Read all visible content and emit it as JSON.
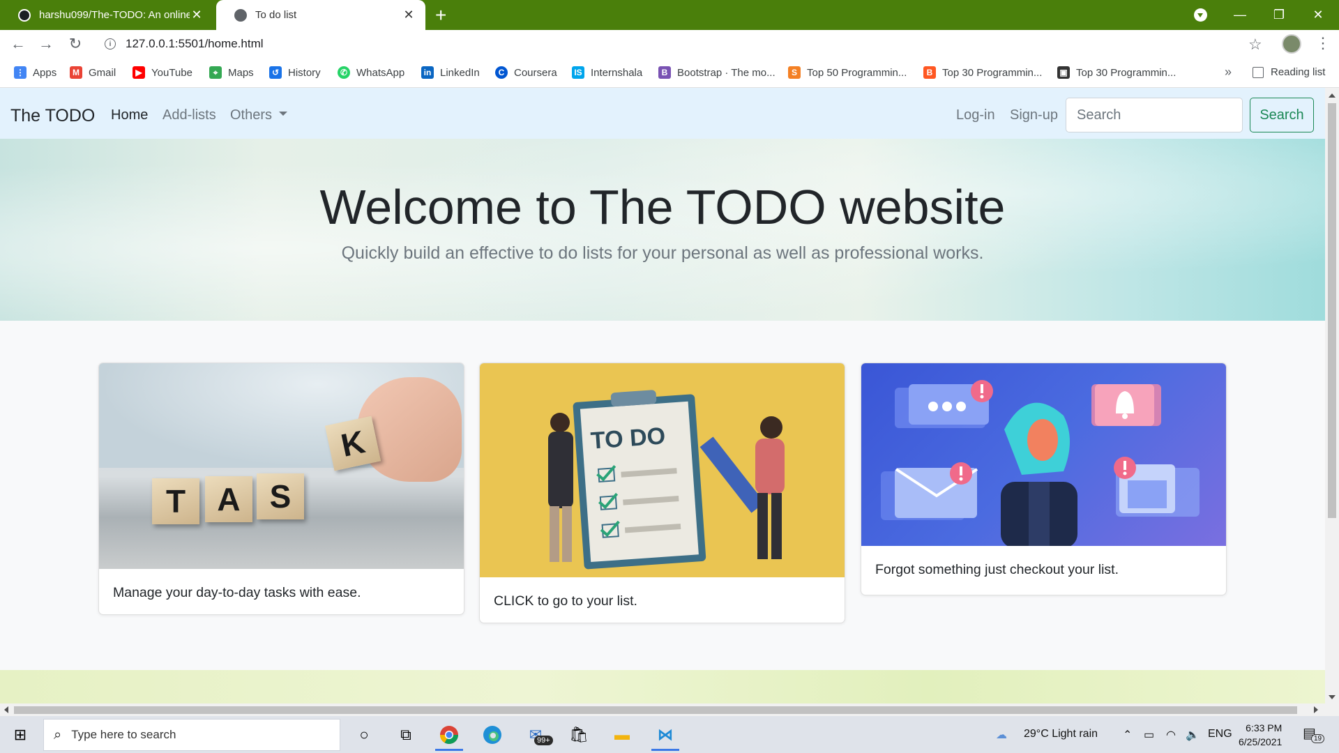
{
  "browser": {
    "tabs": [
      {
        "title": "harshu099/The-TODO: An online",
        "active": false
      },
      {
        "title": "To do list",
        "active": true
      }
    ],
    "url": "127.0.0.1:5501/home.html",
    "bookmarks": [
      {
        "label": "Apps",
        "icon": "apps-grid-icon",
        "color": "#4285f4"
      },
      {
        "label": "Gmail",
        "icon": "gmail-icon",
        "color": "#ea4335"
      },
      {
        "label": "YouTube",
        "icon": "youtube-icon",
        "color": "#ff0000"
      },
      {
        "label": "Maps",
        "icon": "maps-icon",
        "color": "#34a853"
      },
      {
        "label": "History",
        "icon": "history-icon",
        "color": "#1a73e8"
      },
      {
        "label": "WhatsApp",
        "icon": "whatsapp-icon",
        "color": "#25d366"
      },
      {
        "label": "LinkedIn",
        "icon": "linkedin-icon",
        "color": "#0a66c2"
      },
      {
        "label": "Coursera",
        "icon": "coursera-icon",
        "color": "#0056d2"
      },
      {
        "label": "Internshala",
        "icon": "internshala-icon",
        "color": "#00a5ec"
      },
      {
        "label": "Bootstrap · The mo...",
        "icon": "bootstrap-icon",
        "color": "#7952b3"
      },
      {
        "label": "Top 50 Programmin...",
        "icon": "bookmark-icon",
        "color": "#f48024"
      },
      {
        "label": "Top 30 Programmin...",
        "icon": "blogger-icon",
        "color": "#ff5722"
      },
      {
        "label": "Top 30 Programmin...",
        "icon": "bookmark-icon",
        "color": "#333333"
      }
    ],
    "reading_list": "Reading list",
    "more": "»"
  },
  "site": {
    "brand": "The TODO",
    "nav": {
      "home": "Home",
      "add_lists": "Add-lists",
      "others": "Others"
    },
    "login": "Log-in",
    "signup": "Sign-up",
    "search_placeholder": "Search",
    "search_button": "Search"
  },
  "hero": {
    "title": "Welcome to The TODO website",
    "subtitle": "Quickly build an effective to do lists for your personal as well as professional works."
  },
  "cards": [
    {
      "text": "Manage your day-to-day tasks with ease.",
      "image_letters": [
        "T",
        "A",
        "S",
        "K"
      ]
    },
    {
      "text": "CLICK to go to your list.",
      "image_caption": "TO DO"
    },
    {
      "text": "Forgot something just checkout your list."
    }
  ],
  "taskbar": {
    "search_placeholder": "Type here to search",
    "mail_badge": "99+",
    "weather": "29°C  Light rain",
    "language": "ENG",
    "time": "6:33 PM",
    "date": "6/25/2021",
    "notifications": "19"
  },
  "colors": {
    "tabbar": "#4a7f0b",
    "navbar": "#e3f2fd",
    "search_button": "#198754"
  }
}
